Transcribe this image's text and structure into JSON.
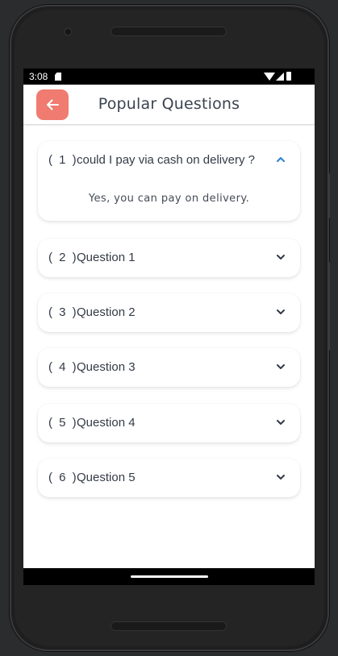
{
  "status_bar": {
    "time": "3:08",
    "icons": [
      "sd-card-icon",
      "wifi-icon",
      "signal-icon",
      "battery-icon"
    ]
  },
  "app_bar": {
    "title": "Popular Questions",
    "back_icon": "arrow-left-icon",
    "accent_color": "#f07b70"
  },
  "faq": {
    "items": [
      {
        "number": "( 1 )",
        "question": "could I pay via cash on delivery ?",
        "answer": "Yes, you can pay on delivery.",
        "expanded": true
      },
      {
        "number": "( 2 )",
        "question": "Question 1",
        "expanded": false
      },
      {
        "number": "( 3 )",
        "question": "Question 2",
        "expanded": false
      },
      {
        "number": "( 4 )",
        "question": "Question 3",
        "expanded": false
      },
      {
        "number": "( 5 )",
        "question": "Question 4",
        "expanded": false
      },
      {
        "number": "( 6 )",
        "question": "Question 5",
        "expanded": false
      }
    ],
    "expanded_chevron_color": "#2a7fd4",
    "collapsed_chevron_color": "#333a46"
  }
}
